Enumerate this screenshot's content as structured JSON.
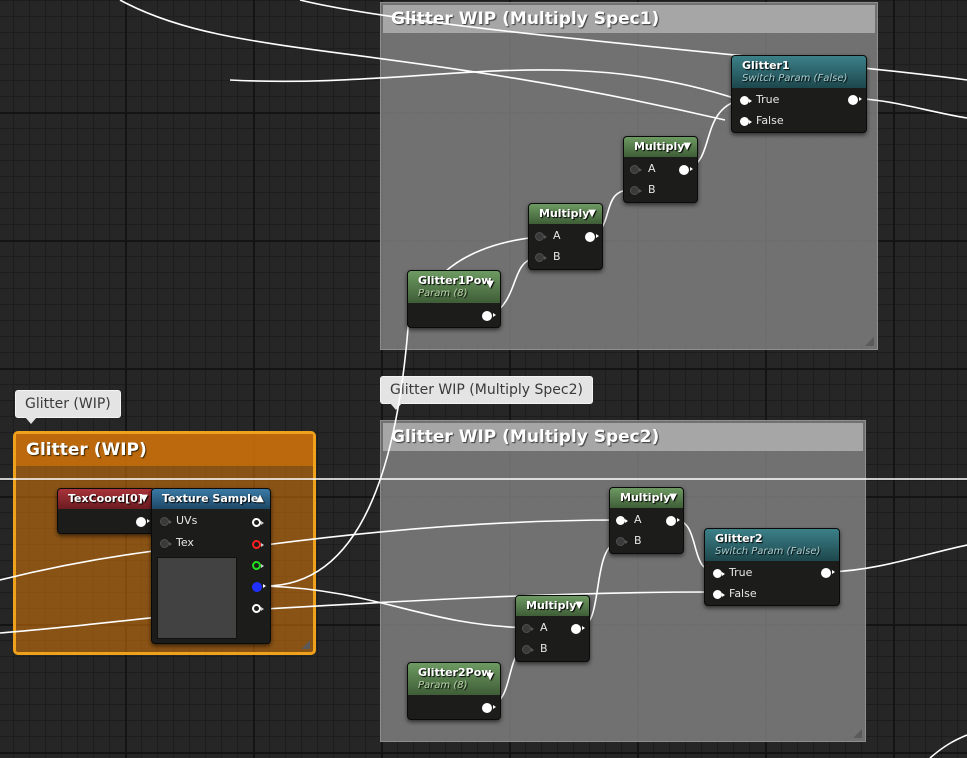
{
  "comments": {
    "spec1_title": "Glitter WIP (Multiply Spec1)",
    "spec2_title": "Glitter WIP (Multiply Spec2)",
    "spec2_bubble": "Glitter WIP (Multiply Spec2)",
    "group_bubble": "Glitter (WIP)",
    "group_title": "Glitter (WIP)"
  },
  "nodes": {
    "glitter1": {
      "title": "Glitter1",
      "subtitle": "Switch Param (False)",
      "pin_true": "True",
      "pin_false": "False"
    },
    "multiply_top": {
      "title": "Multiply",
      "pin_a": "A",
      "pin_b": "B"
    },
    "multiply_mid": {
      "title": "Multiply",
      "pin_a": "A",
      "pin_b": "B"
    },
    "glitter1pow": {
      "title": "Glitter1Pow",
      "subtitle": "Param (8)"
    },
    "multiply_spec2_top": {
      "title": "Multiply",
      "pin_a": "A",
      "pin_b": "B"
    },
    "glitter2": {
      "title": "Glitter2",
      "subtitle": "Switch Param (False)",
      "pin_true": "True",
      "pin_false": "False"
    },
    "multiply_spec2_bottom": {
      "title": "Multiply",
      "pin_a": "A",
      "pin_b": "B"
    },
    "glitter2pow": {
      "title": "Glitter2Pow",
      "subtitle": "Param (8)"
    },
    "texcoord": {
      "title": "TexCoord[0]"
    },
    "texture_sample": {
      "title": "Texture Sample",
      "pin_uvs": "UVs",
      "pin_tex": "Tex"
    }
  },
  "icons": {
    "collapse": "triangle-down-icon",
    "expand": "triangle-up-icon"
  },
  "colors": {
    "graph_bg": "#262626",
    "comment_box": "#828282",
    "group_orange": "#f0a11c",
    "param_header": "#4f7545",
    "switch_header": "#2b6168",
    "texcoord_header": "#8a252b",
    "texture_header": "#2a5f85",
    "pin_red": "#ff2020",
    "pin_green": "#20e020",
    "pin_blue": "#2030ff"
  }
}
